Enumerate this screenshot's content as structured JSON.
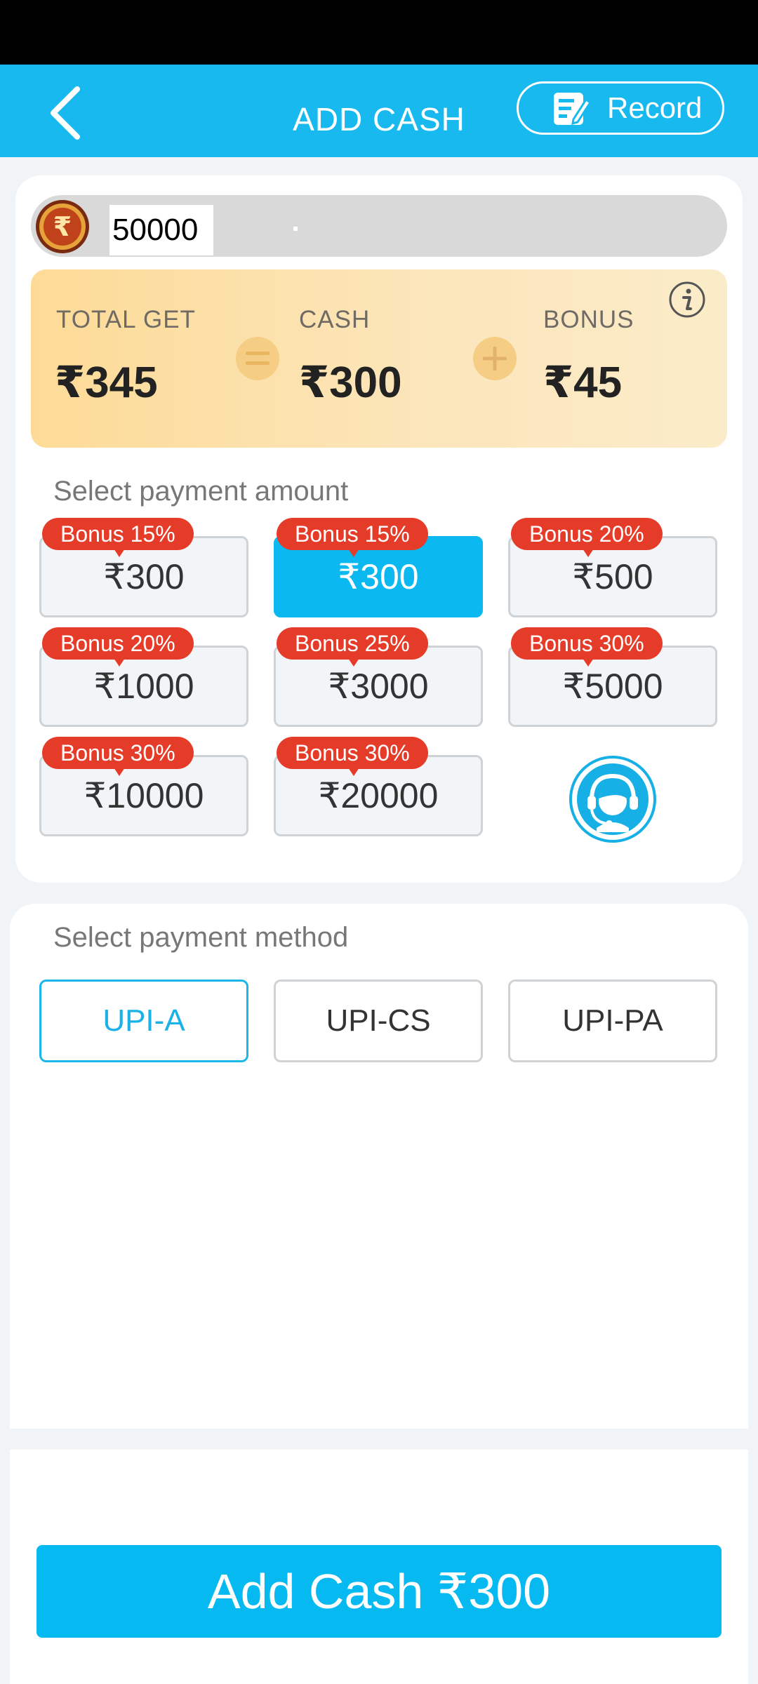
{
  "header": {
    "title": "ADD CASH",
    "record_label": "Record"
  },
  "amount_input": {
    "value": "50000"
  },
  "summary": {
    "total_label": "TOTAL GET",
    "total_value": "₹345",
    "cash_label": "CASH",
    "cash_value": "₹300",
    "bonus_label": "BONUS",
    "bonus_value": "₹45"
  },
  "payment_amount": {
    "label": "Select payment amount",
    "options": [
      {
        "amount": "₹300",
        "bonus": "Bonus 15%",
        "selected": false
      },
      {
        "amount": "₹300",
        "bonus": "Bonus 15%",
        "selected": true
      },
      {
        "amount": "₹500",
        "bonus": "Bonus 20%",
        "selected": false
      },
      {
        "amount": "₹1000",
        "bonus": "Bonus 20%",
        "selected": false
      },
      {
        "amount": "₹3000",
        "bonus": "Bonus 25%",
        "selected": false
      },
      {
        "amount": "₹5000",
        "bonus": "Bonus 30%",
        "selected": false
      },
      {
        "amount": "₹10000",
        "bonus": "Bonus 30%",
        "selected": false
      },
      {
        "amount": "₹20000",
        "bonus": "Bonus 30%",
        "selected": false
      }
    ]
  },
  "payment_method": {
    "label": "Select payment method",
    "options": [
      {
        "label": "UPI-A",
        "selected": true
      },
      {
        "label": "UPI-CS",
        "selected": false
      },
      {
        "label": "UPI-PA",
        "selected": false
      }
    ]
  },
  "footer": {
    "add_cash_label": "Add Cash ₹300"
  },
  "colors": {
    "header": "#17b9ef",
    "accent": "#06b9f1",
    "bonus_tag": "#e53c2a",
    "summary_bg": "#fddb97"
  },
  "icons": [
    "back-arrow-icon",
    "record-edit-icon",
    "rupee-coin-icon",
    "info-icon",
    "equals-icon",
    "plus-icon",
    "customer-support-icon"
  ]
}
